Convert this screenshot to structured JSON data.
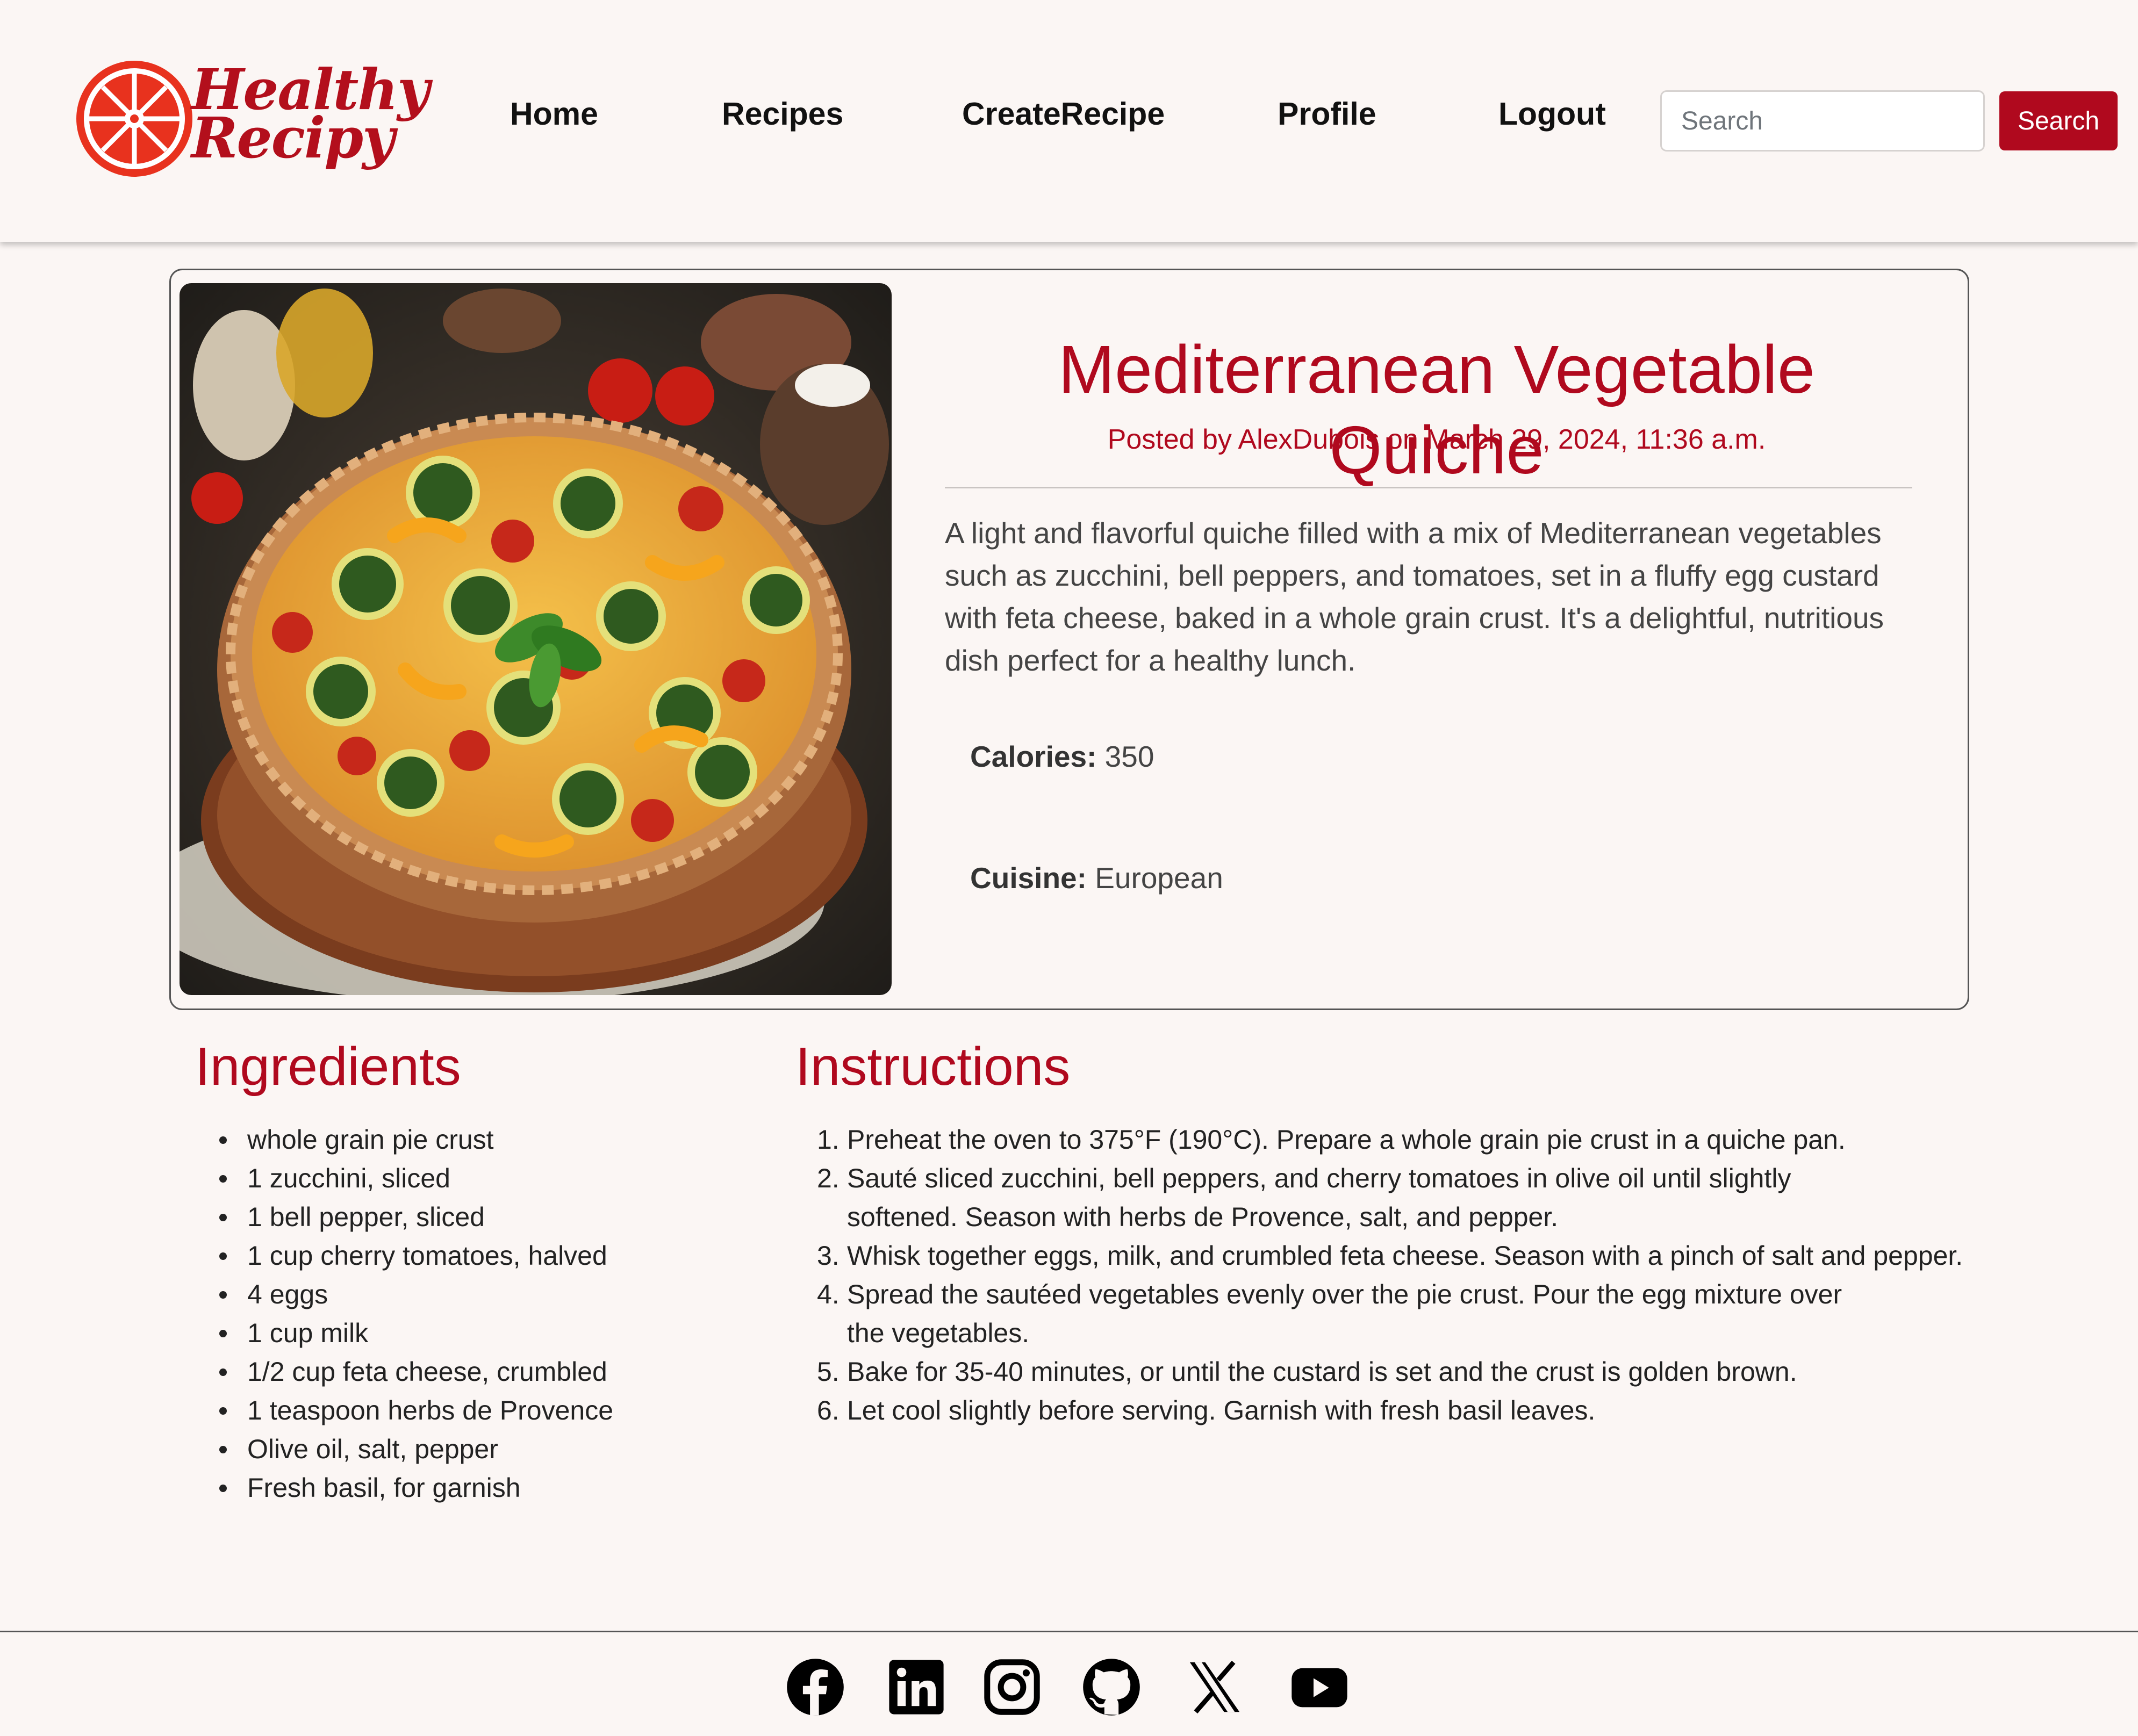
{
  "brand": {
    "line1": "Healthy",
    "line2": "Recipy",
    "color": "#b0091e"
  },
  "nav": {
    "items": [
      {
        "label": "Home"
      },
      {
        "label": "Recipes"
      },
      {
        "label": "CreateRecipe"
      },
      {
        "label": "Profile"
      },
      {
        "label": "Logout"
      }
    ]
  },
  "search": {
    "placeholder": "Search",
    "button_label": "Search"
  },
  "recipe": {
    "title": "Mediterranean Vegetable Quiche",
    "posted": "Posted by AlexDubois on March 29, 2024, 11:36 a.m.",
    "description": "A light and flavorful quiche filled with a mix of Mediterranean vegetables such as zucchini, bell peppers, and tomatoes, set in a fluffy egg custard with feta cheese, baked in a whole grain crust. It's a delightful, nutritious dish perfect for a healthy lunch.",
    "calories_label": "Calories:",
    "calories_value": "350",
    "cuisine_label": "Cuisine:",
    "cuisine_value": "European"
  },
  "ingredients": {
    "heading": "Ingredients",
    "items": [
      "whole grain pie crust",
      "1 zucchini, sliced",
      "1 bell pepper, sliced",
      "1 cup cherry tomatoes, halved",
      "4 eggs",
      "1 cup milk",
      "1/2 cup feta cheese, crumbled",
      "1 teaspoon herbs de Provence",
      "Olive oil, salt, pepper",
      "Fresh basil, for garnish"
    ]
  },
  "instructions": {
    "heading": "Instructions",
    "steps": [
      {
        "num": "1.",
        "text": "Preheat the oven to 375°F (190°C). Prepare a whole grain pie crust in a quiche pan."
      },
      {
        "num": "2.",
        "text": "Sauté sliced zucchini, bell peppers, and cherry tomatoes in olive oil until slightly softened. Season with herbs de Provence, salt, and pepper."
      },
      {
        "num": "3.",
        "text": "Whisk together eggs, milk, and crumbled feta cheese. Season with a pinch of salt and pepper."
      },
      {
        "num": "4.",
        "text": "Spread the sautéed vegetables evenly over the pie crust. Pour the egg mixture over the vegetables."
      },
      {
        "num": "5.",
        "text": "Bake for 35-40 minutes, or until the custard is set and the crust is golden brown."
      },
      {
        "num": "6.",
        "text": "Let cool slightly before serving. Garnish with fresh basil leaves."
      }
    ]
  },
  "footer": {
    "social_icons": [
      "facebook-icon",
      "linkedin-icon",
      "instagram-icon",
      "github-icon",
      "x-icon",
      "youtube-icon"
    ]
  }
}
